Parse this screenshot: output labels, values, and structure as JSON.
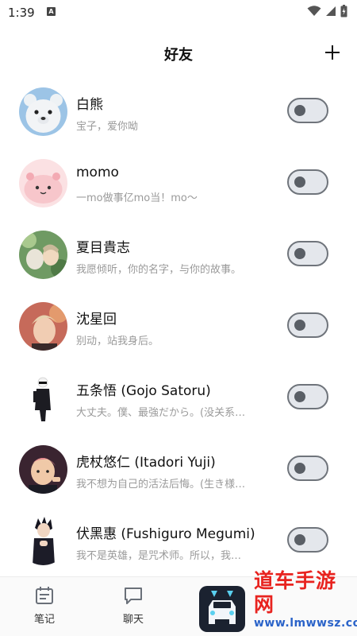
{
  "status_bar": {
    "time": "1:39",
    "indicator": "A",
    "icons": [
      "wifi-icon",
      "signal-icon",
      "battery-charging-icon"
    ]
  },
  "header": {
    "title": "好友",
    "add_icon": "plus-icon"
  },
  "friends": [
    {
      "name": "白熊",
      "desc": "宝子，爱你呦",
      "toggle_on": false
    },
    {
      "name": "momo",
      "desc": "一mo做事亿mo当！mo～",
      "toggle_on": false
    },
    {
      "name": "夏目貴志",
      "desc": "我愿倾听，你的名字，与你的故事。",
      "toggle_on": false
    },
    {
      "name": "沈星回",
      "desc": "别动，站我身后。",
      "toggle_on": false
    },
    {
      "name": "五条悟 (Gojo Satoru)",
      "desc": "大丈夫。僕、最強だから。(没关系…",
      "toggle_on": false
    },
    {
      "name": "虎杖悠仁 (Itadori Yuji)",
      "desc": "我不想为自己的活法后悔。(生き様…",
      "toggle_on": false
    },
    {
      "name": "伏黑惠 (Fushiguro Megumi)",
      "desc": "我不是英雄，是咒术师。所以，我…",
      "toggle_on": false
    }
  ],
  "bottom_nav": {
    "items": [
      {
        "label": "笔记",
        "icon": "notes-icon"
      },
      {
        "label": "聊天",
        "icon": "chat-icon"
      }
    ],
    "center_app_icon": "car-app-icon"
  },
  "watermark": {
    "title": "道车手游网",
    "url": "www.lmwwsz.com"
  }
}
